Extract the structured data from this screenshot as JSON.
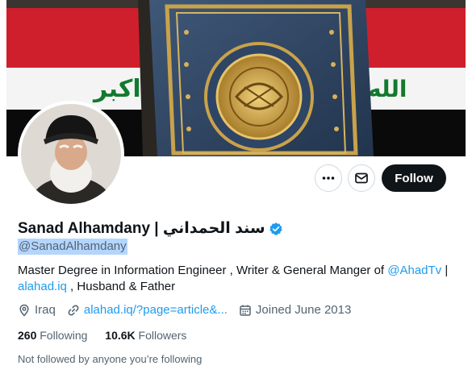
{
  "banner": {
    "left_text": "اكبر",
    "right_text": "الله"
  },
  "actions": {
    "more_icon": "more-horizontal-icon",
    "message_icon": "envelope-icon",
    "follow_label": "Follow"
  },
  "profile": {
    "name": "Sanad Alhamdany | سند الحمداني",
    "verified_icon": "verified-badge-icon",
    "handle": "@SanadAlhamdany",
    "bio_text": "Master Degree in Information Engineer , Writer & General Manger of ",
    "bio_mention": "@AhadTv",
    "bio_separator": " |",
    "bio_link": "alahad.iq",
    "bio_tail": " , Husband & Father",
    "location": "Iraq",
    "website": "alahad.iq/?page=article&...",
    "joined": "Joined June 2013"
  },
  "stats": {
    "following_count": "260",
    "following_label": "Following",
    "followers_count": "10.6K",
    "followers_label": "Followers"
  },
  "note": "Not followed by anyone you’re following",
  "colors": {
    "accent": "#1d9bf0",
    "flag_red": "#cf1f2c",
    "flag_green": "#127a2e",
    "follow_bg": "#0f1419"
  }
}
